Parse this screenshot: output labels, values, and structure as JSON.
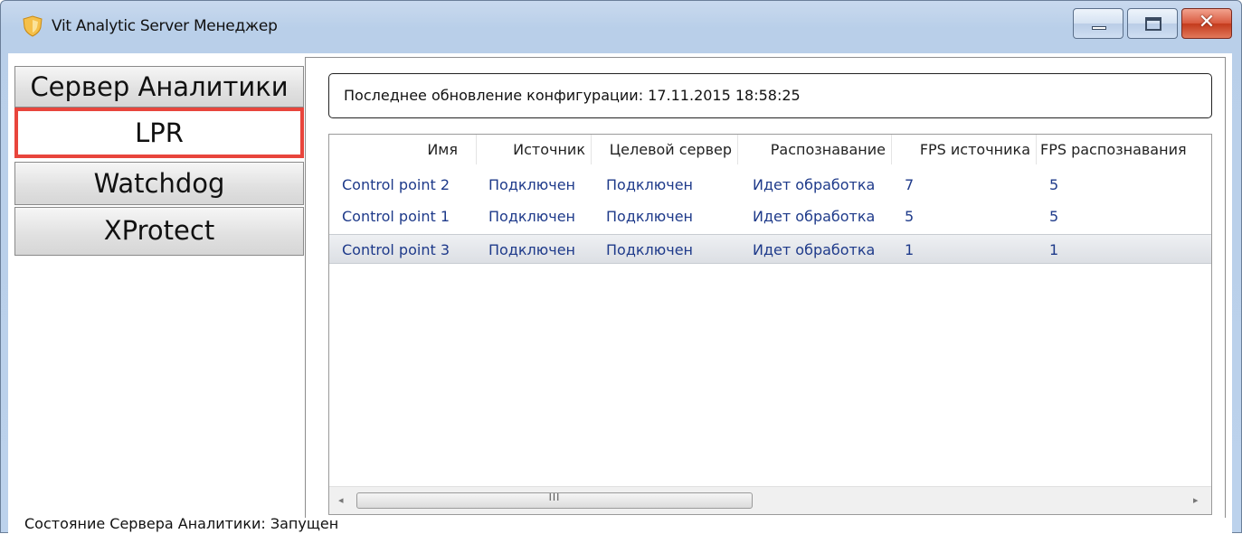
{
  "window": {
    "title": "Vit Analytic Server Менеджер",
    "icon": "shield-logo-icon",
    "controls": {
      "minimize": "minimize-icon",
      "maximize": "maximize-icon",
      "close": "close-icon",
      "close_glyph": "✕"
    }
  },
  "sidebar": {
    "items": [
      {
        "label": "Сервер Аналитики",
        "active": false
      },
      {
        "label": "LPR",
        "active": true
      },
      {
        "label": "Watchdog",
        "active": false
      },
      {
        "label": "XProtect",
        "active": false
      }
    ]
  },
  "update": {
    "text": "Последнее обновление конфигурации: 17.11.2015 18:58:25"
  },
  "table": {
    "columns": [
      "Имя",
      "Источник",
      "Целевой сервер",
      "Распознавание",
      "FPS источника",
      "FPS распознавания"
    ],
    "rows": [
      [
        "Control point 2",
        "Подключен",
        "Подключен",
        "Идет обработка",
        "7",
        "5"
      ],
      [
        "Control point 1",
        "Подключен",
        "Подключен",
        "Идет обработка",
        "5",
        "5"
      ],
      [
        "Control point 3",
        "Подключен",
        "Подключен",
        "Идет обработка",
        "1",
        "1"
      ]
    ],
    "selected_row": 2,
    "scrollbar": {
      "left_arrow": "◂",
      "right_arrow": "▸",
      "grip": "III"
    }
  },
  "status": {
    "text": "Состояние Сервера Аналитики: Запущен"
  },
  "colors": {
    "active_border": "#e8453c",
    "row_text": "#1e3a8a",
    "title_bar": "#b9cfe9"
  }
}
